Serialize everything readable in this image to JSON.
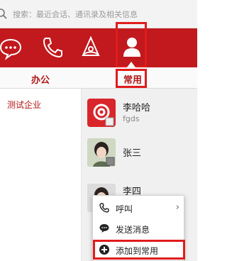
{
  "search": {
    "placeholder": "搜索：最近会话、通讯录及相关信息"
  },
  "toolbar": {
    "more": "···"
  },
  "tabs": {
    "work": "办公",
    "frequent": "常用"
  },
  "sidebar": {
    "org": "测试企业"
  },
  "contacts": [
    {
      "name": "李哈哈",
      "sub": "fgds"
    },
    {
      "name": "张三",
      "sub": ""
    },
    {
      "name": "李四",
      "sub": ""
    }
  ],
  "menu": {
    "call": "呼叫",
    "send": "发送消息",
    "add": "添加到常用"
  },
  "colors": {
    "brand": "#c1191d",
    "highlight": "#e01c1c"
  }
}
